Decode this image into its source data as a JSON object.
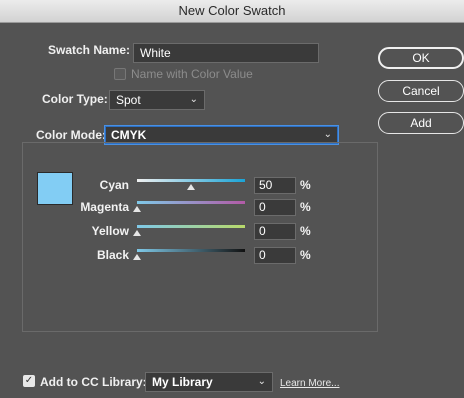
{
  "window": {
    "title": "New Color Swatch"
  },
  "swatch_name": {
    "label": "Swatch Name:",
    "value": "White"
  },
  "name_with_color_value": {
    "label": "Name with Color Value",
    "checked": false,
    "disabled": true
  },
  "color_type": {
    "label": "Color Type:",
    "value": "Spot"
  },
  "color_mode": {
    "label": "Color Mode:",
    "value": "CMYK"
  },
  "buttons": {
    "ok": "OK",
    "cancel": "Cancel",
    "add": "Add"
  },
  "preview_color": "#82cdf4",
  "sliders": [
    {
      "label": "Cyan",
      "value": "50",
      "unit": "%",
      "fraction": 0.5,
      "gradient": [
        "#f0f0f0",
        "#1aa3d6"
      ]
    },
    {
      "label": "Magenta",
      "value": "0",
      "unit": "%",
      "fraction": 0.0,
      "gradient": [
        "#7fc9e8",
        "#b25aa6"
      ]
    },
    {
      "label": "Yellow",
      "value": "0",
      "unit": "%",
      "fraction": 0.0,
      "gradient": [
        "#7fc9e8",
        "#b8d96a"
      ]
    },
    {
      "label": "Black",
      "value": "0",
      "unit": "%",
      "fraction": 0.0,
      "gradient": [
        "#7fc9e8",
        "#111111"
      ]
    }
  ],
  "cc_library": {
    "label": "Add to CC Library:",
    "checked": true,
    "value": "My Library",
    "learn_more": "Learn More..."
  }
}
